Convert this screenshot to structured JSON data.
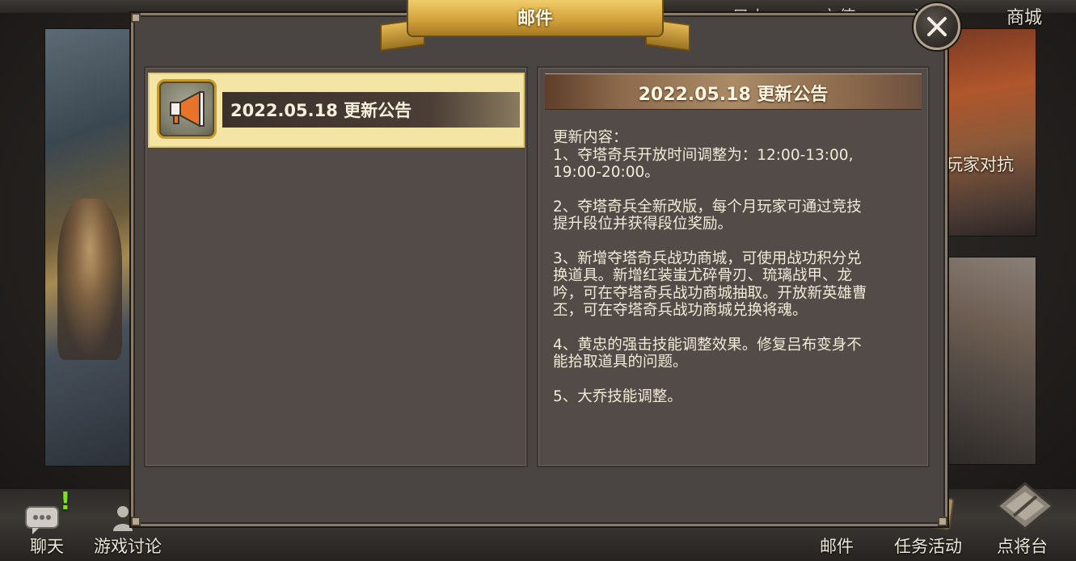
{
  "top_nav": {
    "item_1": "日上",
    "item_2": "充值",
    "item_3": "活",
    "shop": "商城"
  },
  "background_art": {
    "right_banner_label": "玩家对抗"
  },
  "bottom_nav": {
    "chat": "聊天",
    "discussion": "游戏讨论",
    "mail": "邮件",
    "tasks": "任务活动",
    "generals": "点将台",
    "chat_alert_mark": "!"
  },
  "dialog": {
    "title": "邮件",
    "close_icon": "close-icon"
  },
  "mail_list": {
    "items": [
      {
        "title": "2022.05.18 更新公告",
        "icon": "megaphone-icon",
        "selected": true
      }
    ]
  },
  "mail_detail": {
    "title": "2022.05.18 更新公告",
    "paragraphs": [
      "更新内容：\n1、夺塔奇兵开放时间调整为：12:00-13:00,\n19:00-20:00。",
      "2、夺塔奇兵全新改版，每个月玩家可通过竞技\n提升段位并获得段位奖励。",
      "3、新增夺塔奇兵战功商城，可使用战功积分兑\n换道具。新增红装蚩尤碎骨刃、琉璃战甲、龙\n吟，可在夺塔奇兵战功商城抽取。开放新英雄曹\n丕，可在夺塔奇兵战功商城兑换将魂。",
      "4、黄忠的强击技能调整效果。修复吕布变身不\n能拾取道具的问题。",
      "5、大乔技能调整。"
    ]
  },
  "colors": {
    "selected_item_bg": "#f4e5a4",
    "ribbon_gold": "#d3a23c",
    "panel_bg": "#534b47",
    "megaphone_orange": "#e8742c",
    "alert_green": "#7ee020"
  }
}
